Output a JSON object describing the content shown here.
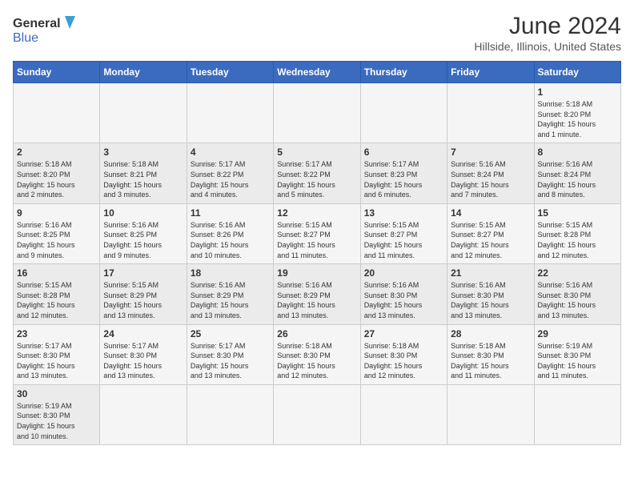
{
  "header": {
    "logo_line1": "General",
    "logo_line2": "Blue",
    "title": "June 2024",
    "subtitle": "Hillside, Illinois, United States"
  },
  "days_of_week": [
    "Sunday",
    "Monday",
    "Tuesday",
    "Wednesday",
    "Thursday",
    "Friday",
    "Saturday"
  ],
  "weeks": [
    [
      {
        "day": "",
        "info": ""
      },
      {
        "day": "",
        "info": ""
      },
      {
        "day": "",
        "info": ""
      },
      {
        "day": "",
        "info": ""
      },
      {
        "day": "",
        "info": ""
      },
      {
        "day": "",
        "info": ""
      },
      {
        "day": "1",
        "info": "Sunrise: 5:18 AM\nSunset: 8:20 PM\nDaylight: 15 hours\nand 1 minute."
      }
    ],
    [
      {
        "day": "2",
        "info": "Sunrise: 5:18 AM\nSunset: 8:20 PM\nDaylight: 15 hours\nand 2 minutes."
      },
      {
        "day": "3",
        "info": "Sunrise: 5:18 AM\nSunset: 8:21 PM\nDaylight: 15 hours\nand 3 minutes."
      },
      {
        "day": "4",
        "info": "Sunrise: 5:17 AM\nSunset: 8:22 PM\nDaylight: 15 hours\nand 4 minutes."
      },
      {
        "day": "5",
        "info": "Sunrise: 5:17 AM\nSunset: 8:22 PM\nDaylight: 15 hours\nand 5 minutes."
      },
      {
        "day": "6",
        "info": "Sunrise: 5:17 AM\nSunset: 8:23 PM\nDaylight: 15 hours\nand 6 minutes."
      },
      {
        "day": "7",
        "info": "Sunrise: 5:16 AM\nSunset: 8:24 PM\nDaylight: 15 hours\nand 7 minutes."
      },
      {
        "day": "8",
        "info": "Sunrise: 5:16 AM\nSunset: 8:24 PM\nDaylight: 15 hours\nand 8 minutes."
      }
    ],
    [
      {
        "day": "9",
        "info": "Sunrise: 5:16 AM\nSunset: 8:25 PM\nDaylight: 15 hours\nand 9 minutes."
      },
      {
        "day": "10",
        "info": "Sunrise: 5:16 AM\nSunset: 8:25 PM\nDaylight: 15 hours\nand 9 minutes."
      },
      {
        "day": "11",
        "info": "Sunrise: 5:16 AM\nSunset: 8:26 PM\nDaylight: 15 hours\nand 10 minutes."
      },
      {
        "day": "12",
        "info": "Sunrise: 5:15 AM\nSunset: 8:27 PM\nDaylight: 15 hours\nand 11 minutes."
      },
      {
        "day": "13",
        "info": "Sunrise: 5:15 AM\nSunset: 8:27 PM\nDaylight: 15 hours\nand 11 minutes."
      },
      {
        "day": "14",
        "info": "Sunrise: 5:15 AM\nSunset: 8:27 PM\nDaylight: 15 hours\nand 12 minutes."
      },
      {
        "day": "15",
        "info": "Sunrise: 5:15 AM\nSunset: 8:28 PM\nDaylight: 15 hours\nand 12 minutes."
      }
    ],
    [
      {
        "day": "16",
        "info": "Sunrise: 5:15 AM\nSunset: 8:28 PM\nDaylight: 15 hours\nand 12 minutes."
      },
      {
        "day": "17",
        "info": "Sunrise: 5:15 AM\nSunset: 8:29 PM\nDaylight: 15 hours\nand 13 minutes."
      },
      {
        "day": "18",
        "info": "Sunrise: 5:16 AM\nSunset: 8:29 PM\nDaylight: 15 hours\nand 13 minutes."
      },
      {
        "day": "19",
        "info": "Sunrise: 5:16 AM\nSunset: 8:29 PM\nDaylight: 15 hours\nand 13 minutes."
      },
      {
        "day": "20",
        "info": "Sunrise: 5:16 AM\nSunset: 8:30 PM\nDaylight: 15 hours\nand 13 minutes."
      },
      {
        "day": "21",
        "info": "Sunrise: 5:16 AM\nSunset: 8:30 PM\nDaylight: 15 hours\nand 13 minutes."
      },
      {
        "day": "22",
        "info": "Sunrise: 5:16 AM\nSunset: 8:30 PM\nDaylight: 15 hours\nand 13 minutes."
      }
    ],
    [
      {
        "day": "23",
        "info": "Sunrise: 5:17 AM\nSunset: 8:30 PM\nDaylight: 15 hours\nand 13 minutes."
      },
      {
        "day": "24",
        "info": "Sunrise: 5:17 AM\nSunset: 8:30 PM\nDaylight: 15 hours\nand 13 minutes."
      },
      {
        "day": "25",
        "info": "Sunrise: 5:17 AM\nSunset: 8:30 PM\nDaylight: 15 hours\nand 13 minutes."
      },
      {
        "day": "26",
        "info": "Sunrise: 5:18 AM\nSunset: 8:30 PM\nDaylight: 15 hours\nand 12 minutes."
      },
      {
        "day": "27",
        "info": "Sunrise: 5:18 AM\nSunset: 8:30 PM\nDaylight: 15 hours\nand 12 minutes."
      },
      {
        "day": "28",
        "info": "Sunrise: 5:18 AM\nSunset: 8:30 PM\nDaylight: 15 hours\nand 11 minutes."
      },
      {
        "day": "29",
        "info": "Sunrise: 5:19 AM\nSunset: 8:30 PM\nDaylight: 15 hours\nand 11 minutes."
      }
    ],
    [
      {
        "day": "30",
        "info": "Sunrise: 5:19 AM\nSunset: 8:30 PM\nDaylight: 15 hours\nand 10 minutes."
      },
      {
        "day": "",
        "info": ""
      },
      {
        "day": "",
        "info": ""
      },
      {
        "day": "",
        "info": ""
      },
      {
        "day": "",
        "info": ""
      },
      {
        "day": "",
        "info": ""
      },
      {
        "day": "",
        "info": ""
      }
    ]
  ]
}
